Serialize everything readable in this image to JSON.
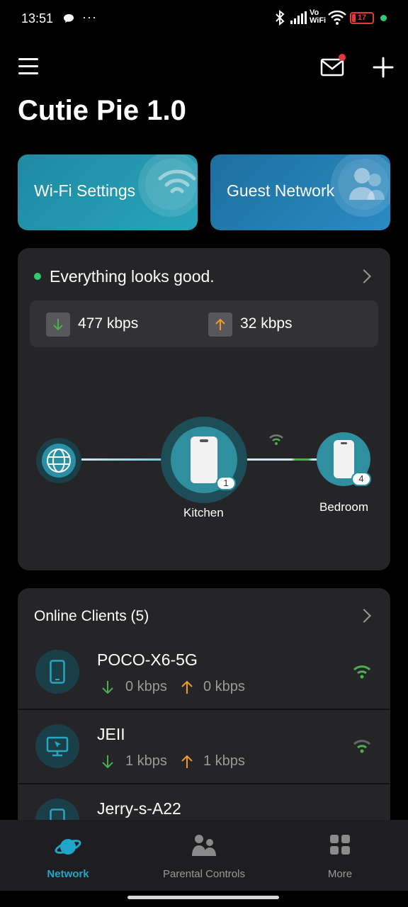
{
  "status_bar": {
    "time": "13:51",
    "dots": "···",
    "vowifi_line1": "Vo",
    "vowifi_line2": "WiFi",
    "battery": "17"
  },
  "header": {
    "title": "Cutie Pie 1.0"
  },
  "tiles": {
    "wifi_settings": "Wi-Fi Settings",
    "guest_network": "Guest Network"
  },
  "network": {
    "status": "Everything looks good.",
    "download": "477 kbps",
    "upload": "32 kbps",
    "nodes": [
      {
        "label": "Kitchen",
        "count": "1"
      },
      {
        "label": "Bedroom",
        "count": "4"
      }
    ]
  },
  "clients": {
    "title": "Online Clients (5)",
    "items": [
      {
        "name": "POCO-X6-5G",
        "down": "0 kbps",
        "up": "0 kbps",
        "icon": "phone-icon"
      },
      {
        "name": "JEII",
        "down": "1 kbps",
        "up": "1 kbps",
        "icon": "monitor-icon"
      },
      {
        "name": "Jerry-s-A22",
        "icon": "phone-icon"
      }
    ]
  },
  "bottom_nav": {
    "items": [
      {
        "label": "Network",
        "active": true
      },
      {
        "label": "Parental Controls",
        "active": false
      },
      {
        "label": "More",
        "active": false
      }
    ]
  },
  "colors": {
    "accent": "#1fa6c9",
    "download": "#4caf50",
    "upload": "#ef9a2a",
    "ok": "#2ecc71",
    "alert": "#e53935"
  }
}
